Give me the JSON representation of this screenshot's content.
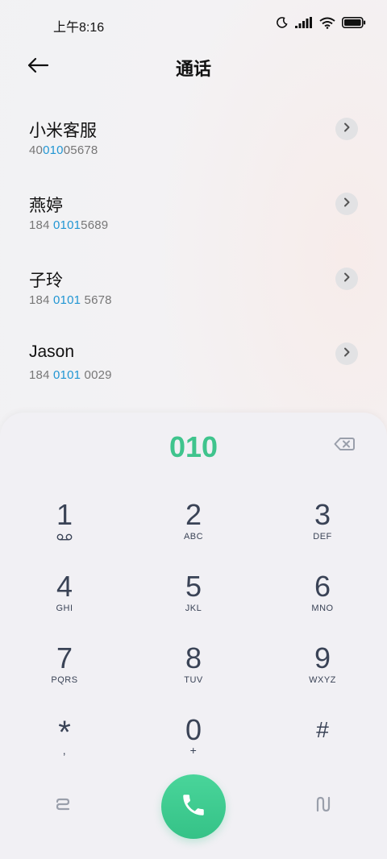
{
  "status": {
    "time": "上午8:16",
    "icons": [
      "moon-icon",
      "signal-icon",
      "wifi-icon",
      "battery-icon"
    ]
  },
  "header": {
    "title": "通话",
    "back_icon": "back-arrow-icon"
  },
  "results": [
    {
      "name": "小米客服",
      "number_pre": "40",
      "number_hl": "010",
      "number_post": "05678"
    },
    {
      "name": "燕婷",
      "number_pre": "184 ",
      "number_hl": "0101",
      "number_post": "5689"
    },
    {
      "name": "子玲",
      "number_pre": "184 ",
      "number_hl": "0101",
      "number_post": " 5678"
    },
    {
      "name": "Jason",
      "number_pre": "184 ",
      "number_hl": "0101",
      "number_post": " 0029"
    }
  ],
  "dialpad": {
    "display": "010",
    "keys": [
      {
        "digit": "1",
        "sub": ""
      },
      {
        "digit": "2",
        "sub": "ABC"
      },
      {
        "digit": "3",
        "sub": "DEF"
      },
      {
        "digit": "4",
        "sub": "GHI"
      },
      {
        "digit": "5",
        "sub": "JKL"
      },
      {
        "digit": "6",
        "sub": "MNO"
      },
      {
        "digit": "7",
        "sub": "PQRS"
      },
      {
        "digit": "8",
        "sub": "TUV"
      },
      {
        "digit": "9",
        "sub": "WXYZ"
      },
      {
        "digit": "*",
        "sub": ","
      },
      {
        "digit": "0",
        "sub": "+"
      },
      {
        "digit": "#",
        "sub": ""
      }
    ]
  },
  "colors": {
    "accent": "#3fc48d",
    "highlight": "#2196d3",
    "key_text": "#3a4356"
  }
}
